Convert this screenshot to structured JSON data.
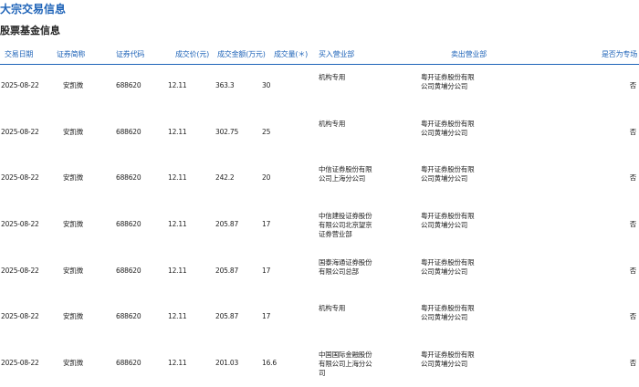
{
  "page": {
    "title": "大宗交易信息",
    "section_title": "股票基金信息"
  },
  "table": {
    "headers": {
      "date": "交易日期",
      "name": "证券简称",
      "code": "证券代码",
      "price": "成交价(元)",
      "amount": "成交金额(万元)",
      "volume": "成交量(＊)",
      "buyer": "买入营业部",
      "seller": "卖出营业部",
      "flag": "是否为专场"
    },
    "rows": [
      {
        "date": "2025-08-22",
        "name": "安凯微",
        "code": "688620",
        "price": "12.11",
        "amount": "363.3",
        "volume": "30",
        "buyer": "机构专用",
        "seller": "粤开证券股份有限公司黄埔分公司",
        "flag": "否"
      },
      {
        "date": "2025-08-22",
        "name": "安凯微",
        "code": "688620",
        "price": "12.11",
        "amount": "302.75",
        "volume": "25",
        "buyer": "机构专用",
        "seller": "粤开证券股份有限公司黄埔分公司",
        "flag": "否"
      },
      {
        "date": "2025-08-22",
        "name": "安凯微",
        "code": "688620",
        "price": "12.11",
        "amount": "242.2",
        "volume": "20",
        "buyer": "中信证券股份有限公司上海分公司",
        "seller": "粤开证券股份有限公司黄埔分公司",
        "flag": "否"
      },
      {
        "date": "2025-08-22",
        "name": "安凯微",
        "code": "688620",
        "price": "12.11",
        "amount": "205.87",
        "volume": "17",
        "buyer": "中信建投证券股份有限公司北京望京证券营业部",
        "seller": "粤开证券股份有限公司黄埔分公司",
        "flag": "否"
      },
      {
        "date": "2025-08-22",
        "name": "安凯微",
        "code": "688620",
        "price": "12.11",
        "amount": "205.87",
        "volume": "17",
        "buyer": "国泰海通证券股份有限公司总部",
        "seller": "粤开证券股份有限公司黄埔分公司",
        "flag": "否"
      },
      {
        "date": "2025-08-22",
        "name": "安凯微",
        "code": "688620",
        "price": "12.11",
        "amount": "205.87",
        "volume": "17",
        "buyer": "机构专用",
        "seller": "粤开证券股份有限公司黄埔分公司",
        "flag": "否"
      },
      {
        "date": "2025-08-22",
        "name": "安凯微",
        "code": "688620",
        "price": "12.11",
        "amount": "201.03",
        "volume": "16.6",
        "buyer": "中国国际金融股份有限公司上海分公司",
        "seller": "粤开证券股份有限公司黄埔分公司",
        "flag": "否"
      }
    ]
  }
}
